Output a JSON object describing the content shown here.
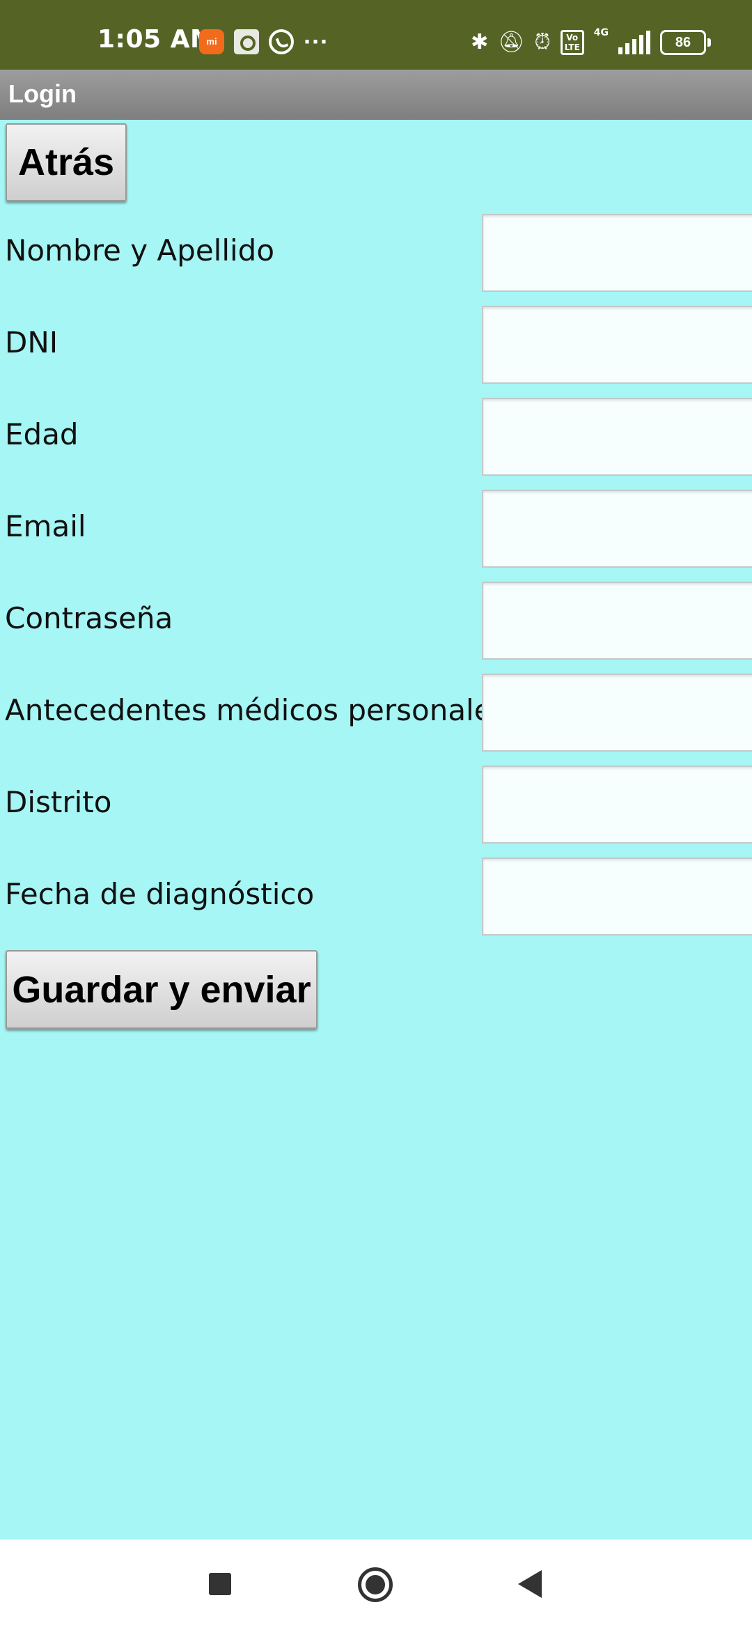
{
  "status_bar": {
    "time": "1:05 AM",
    "notification_icons": [
      "mi-icon",
      "gallery-icon",
      "whatsapp-icon",
      "more-icon"
    ],
    "mi_text": "mi",
    "more": "···",
    "system_icons": [
      "bluetooth-icon",
      "silent-bell-icon",
      "alarm-icon",
      "volte-icon",
      "signal-4g-icon",
      "battery-icon"
    ],
    "volte_text": "Vo\nLTE",
    "network": "4G",
    "battery": "86"
  },
  "title_bar": {
    "title": "Login"
  },
  "back_button": {
    "label": "Atrás"
  },
  "form": {
    "fields": [
      {
        "label": "Nombre y Apellido",
        "value": ""
      },
      {
        "label": "DNI",
        "value": ""
      },
      {
        "label": "Edad",
        "value": ""
      },
      {
        "label": "Email",
        "value": ""
      },
      {
        "label": "Contraseña",
        "value": ""
      },
      {
        "label": "Antecedentes médicos personales",
        "value": ""
      },
      {
        "label": "Distrito",
        "value": ""
      },
      {
        "label": "Fecha de diagnóstico",
        "value": ""
      }
    ]
  },
  "save_button": {
    "label": "Guardar y enviar"
  },
  "nav_bar": {
    "buttons": [
      "recents-button",
      "home-button",
      "back-button"
    ]
  },
  "colors": {
    "status_bar": "#556425",
    "background": "#a5f6f4",
    "title_bar": "#8a8a8a",
    "input_bg": "#f7fefe"
  }
}
